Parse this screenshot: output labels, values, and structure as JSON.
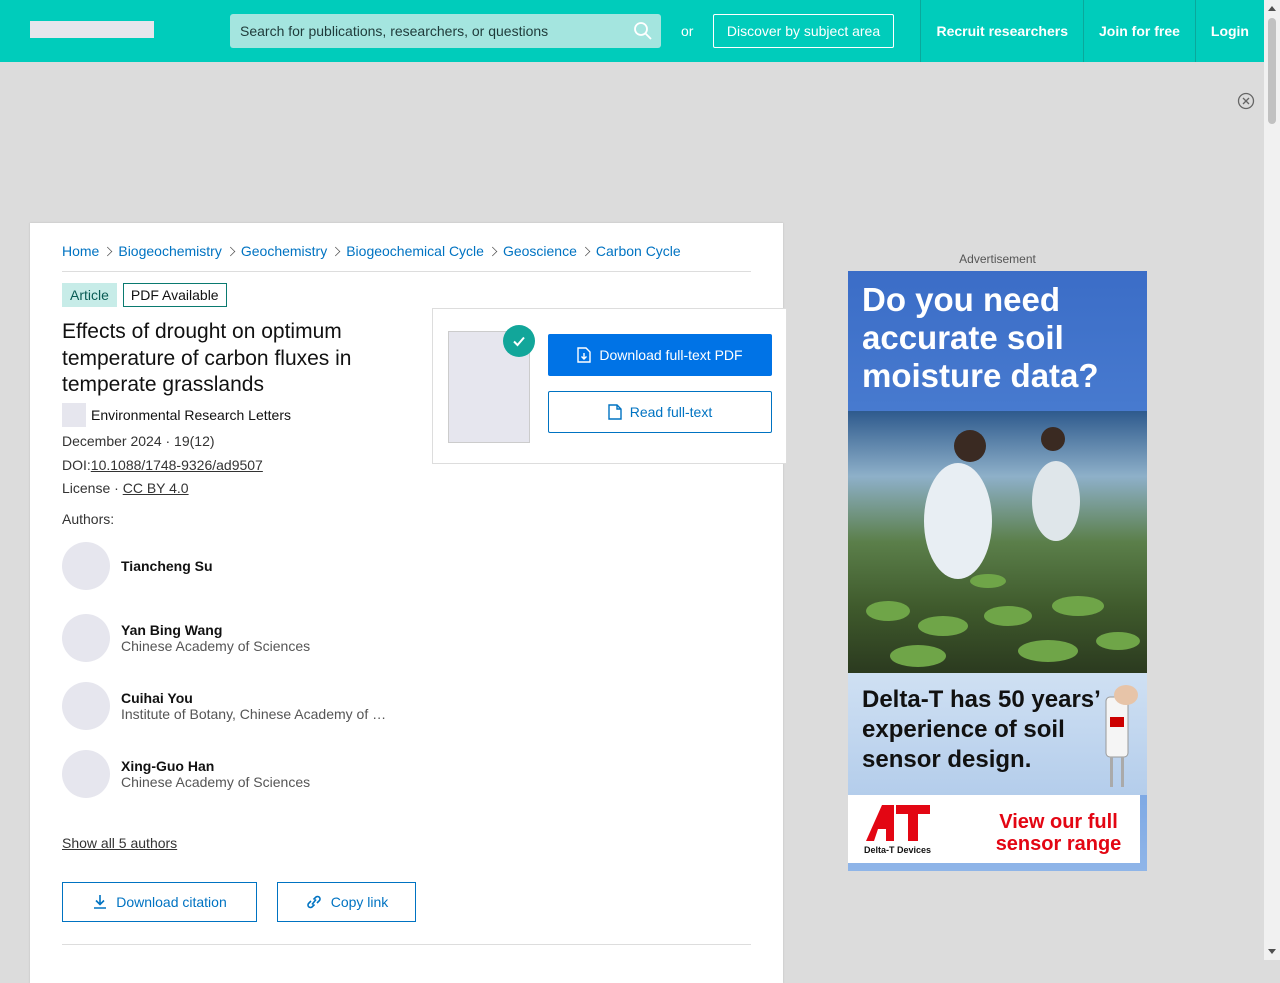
{
  "header": {
    "search_placeholder": "Search for publications, researchers, or questions",
    "or_text": "or",
    "discover_label": "Discover by subject area",
    "nav": [
      "Recruit researchers",
      "Join for free",
      "Login"
    ]
  },
  "breadcrumb": [
    "Home",
    "Biogeochemistry",
    "Geochemistry",
    "Biogeochemical Cycle",
    "Geoscience",
    "Carbon Cycle"
  ],
  "badges": {
    "type": "Article",
    "availability": "PDF Available"
  },
  "article": {
    "title": "Effects of drought on optimum temperature of carbon fluxes in temperate grasslands",
    "journal": "Environmental Research Letters",
    "date_issue": "December 2024 · 19(12)",
    "doi_label": "DOI:",
    "doi": "10.1088/1748-9326/ad9507",
    "license_label": "License · ",
    "license": "CC BY 4.0"
  },
  "authors_label": "Authors:",
  "authors": [
    {
      "name": "Tiancheng Su",
      "affiliation": ""
    },
    {
      "name": "Yan Bing Wang",
      "affiliation": "Chinese Academy of Sciences"
    },
    {
      "name": "Cuihai You",
      "affiliation": "Institute of Botany, Chinese Academy of Sciences"
    },
    {
      "name": "Xing-Guo Han",
      "affiliation": "Chinese Academy of Sciences"
    }
  ],
  "show_all_authors": "Show all 5 authors",
  "actions": {
    "download_citation": "Download citation",
    "copy_link": "Copy link"
  },
  "download_panel": {
    "download_pdf": "Download full-text PDF",
    "read_fulltext": "Read full-text"
  },
  "ad": {
    "label": "Advertisement",
    "headline": "Do you need accurate soil moisture data?",
    "subline": "Delta-T has 50 years’ experience of soil sensor design.",
    "logo_text": "Delta-T Devices",
    "cta": "View our full sensor range"
  },
  "colors": {
    "brand": "#00ccbb",
    "link": "#0073c2",
    "primary_button": "#0073e6"
  }
}
